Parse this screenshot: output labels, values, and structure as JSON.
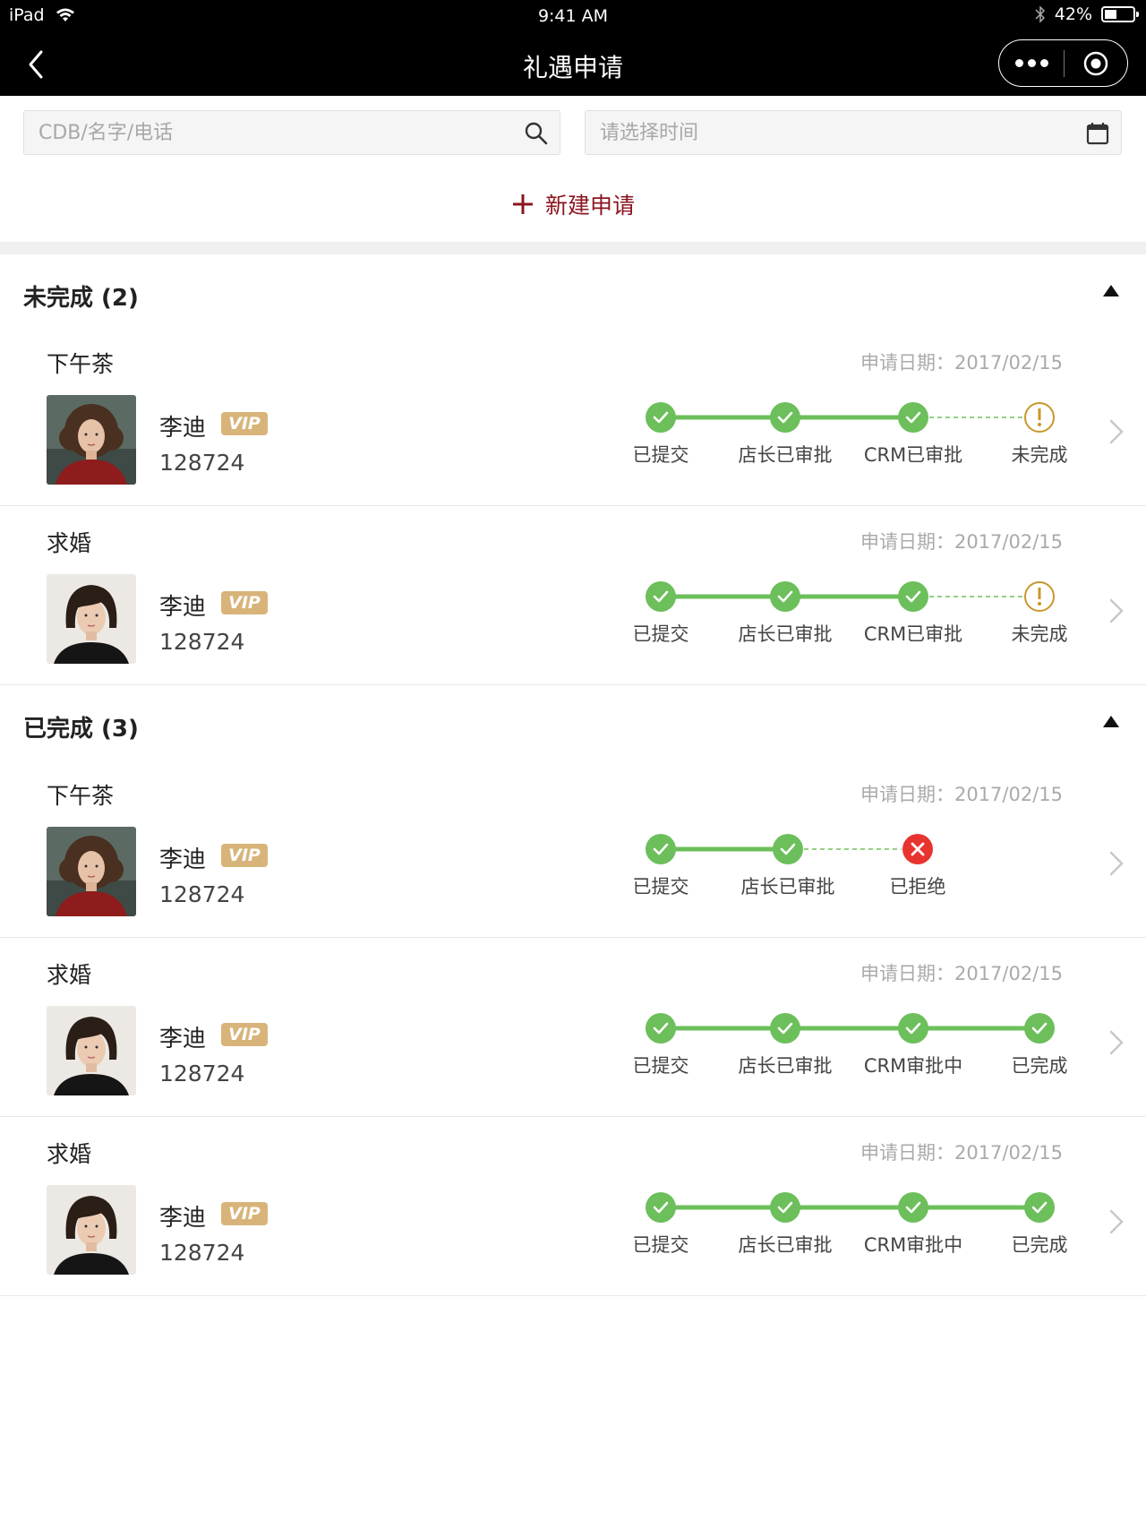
{
  "status_bar": {
    "device": "iPad",
    "time": "9:41 AM",
    "battery": "42%",
    "battery_level": 0.42
  },
  "nav": {
    "title": "礼遇申请"
  },
  "search": {
    "placeholder": "CDB/名字/电话",
    "date_placeholder": "请选择时间"
  },
  "new_request": {
    "label": "新建申请"
  },
  "sections": [
    {
      "title": "未完成 (2)"
    },
    {
      "title": "已完成 (3)"
    }
  ],
  "cards": [
    {
      "type": "下午茶",
      "date": "申请日期：2017/02/15",
      "name": "李迪",
      "vip": "VIP",
      "phone": "128724",
      "avatar": "curly-hair-woman",
      "steps": [
        {
          "label": "已提交",
          "status": "done"
        },
        {
          "label": "店长已审批",
          "status": "done"
        },
        {
          "label": "CRM已审批",
          "status": "done"
        },
        {
          "label": "未完成",
          "status": "pending"
        }
      ]
    },
    {
      "type": "求婚",
      "date": "申请日期：2017/02/15",
      "name": "李迪",
      "vip": "VIP",
      "phone": "128724",
      "avatar": "short-hair-woman",
      "steps": [
        {
          "label": "已提交",
          "status": "done"
        },
        {
          "label": "店长已审批",
          "status": "done"
        },
        {
          "label": "CRM已审批",
          "status": "done"
        },
        {
          "label": "未完成",
          "status": "pending"
        }
      ]
    },
    {
      "type": "下午茶",
      "date": "申请日期：2017/02/15",
      "name": "李迪",
      "vip": "VIP",
      "phone": "128724",
      "avatar": "curly-hair-woman",
      "steps": [
        {
          "label": "已提交",
          "status": "done"
        },
        {
          "label": "店长已审批",
          "status": "done"
        },
        {
          "label": "已拒绝",
          "status": "rejected"
        }
      ]
    },
    {
      "type": "求婚",
      "date": "申请日期：2017/02/15",
      "name": "李迪",
      "vip": "VIP",
      "phone": "128724",
      "avatar": "short-hair-woman",
      "steps": [
        {
          "label": "已提交",
          "status": "done"
        },
        {
          "label": "店长已审批",
          "status": "done"
        },
        {
          "label": "CRM审批中",
          "status": "done"
        },
        {
          "label": "已完成",
          "status": "done"
        }
      ]
    },
    {
      "type": "求婚",
      "date": "申请日期：2017/02/15",
      "name": "李迪",
      "vip": "VIP",
      "phone": "128724",
      "avatar": "short-hair-woman",
      "steps": [
        {
          "label": "已提交",
          "status": "done"
        },
        {
          "label": "店长已审批",
          "status": "done"
        },
        {
          "label": "CRM审批中",
          "status": "done"
        },
        {
          "label": "已完成",
          "status": "done"
        }
      ]
    }
  ],
  "colors": {
    "accent": "#8b1520",
    "done": "#6cbf5a",
    "pending": "#c9972a",
    "rejected": "#e8342e",
    "vip": "#d8b47a"
  }
}
